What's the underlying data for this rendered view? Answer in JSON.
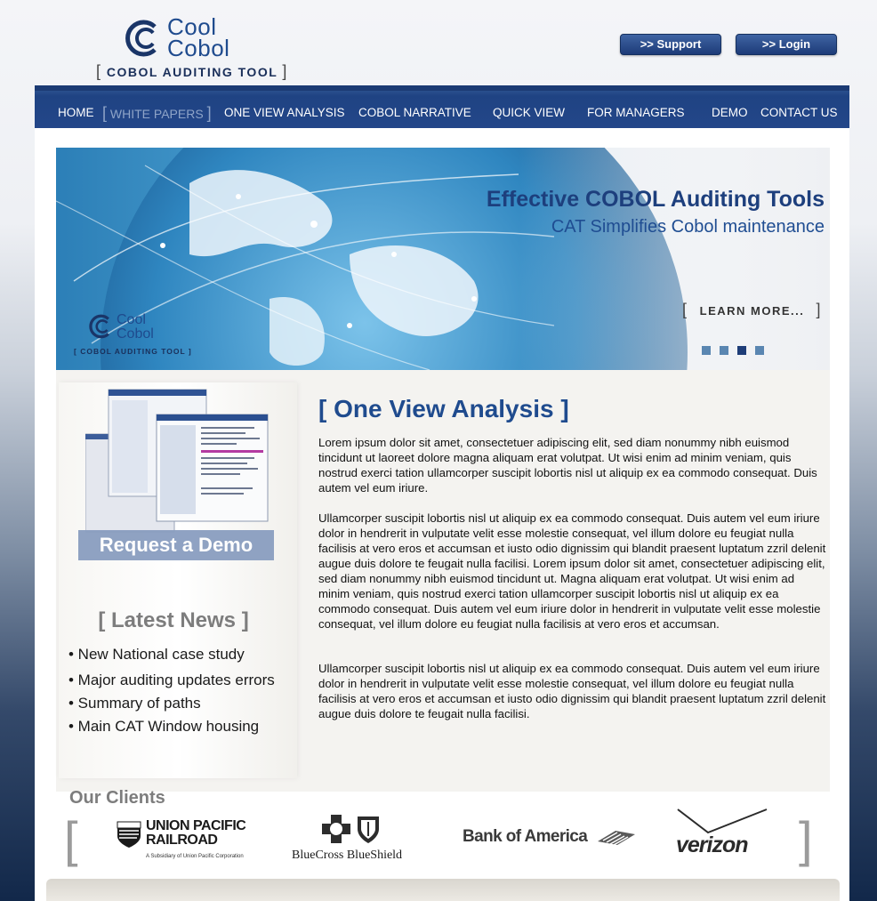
{
  "logo": {
    "line1": "Cool",
    "line2": "Cobol",
    "tagline": "COBOL AUDITING TOOL",
    "bracket_left": "[",
    "bracket_right": "]"
  },
  "top_buttons": {
    "support": ">> Support",
    "login": ">> Login"
  },
  "nav": {
    "home": "HOME",
    "white_papers": "WHITE PAPERS",
    "bracket_left": "[",
    "bracket_right": "]",
    "one_view": "ONE VIEW ANALYSIS",
    "narrative": "COBOL NARRATIVE",
    "quick_view": "QUICK VIEW",
    "managers": "FOR MANAGERS",
    "demo": "DEMO",
    "contact": "CONTACT US"
  },
  "hero": {
    "title": "Effective COBOL Auditing Tools",
    "subtitle": "CAT Simplifies Cobol maintenance",
    "learn_more": "LEARN MORE...",
    "bracket_left": "[",
    "bracket_right": "]",
    "slide_count": 4,
    "active_slide": 3,
    "logo_line1": "Cool",
    "logo_line2": "Cobol",
    "logo_tagline": "COBOL AUDITING TOOL"
  },
  "demo": {
    "label": "Request a Demo"
  },
  "news": {
    "title": "[ Latest News ]",
    "items": [
      "• New National case study",
      "• Major auditing updates errors",
      "• Summary of paths",
      "• Main CAT Window housing"
    ]
  },
  "main": {
    "title": "[ One View Analysis ]",
    "paragraphs": [
      "Lorem ipsum dolor sit amet, consectetuer adipiscing elit, sed diam nonummy nibh euismod tincidunt ut laoreet dolore magna aliquam erat volutpat. Ut wisi enim ad minim veniam, quis nostrud exerci tation ullamcorper suscipit lobortis nisl ut aliquip ex ea commodo consequat. Duis autem vel eum iriure.",
      "Ullamcorper suscipit lobortis nisl ut aliquip ex ea commodo consequat. Duis autem vel eum iriure dolor in hendrerit in vulputate velit esse molestie consequat, vel illum dolore eu feugiat nulla facilisis at vero eros et accumsan et iusto odio dignissim qui blandit praesent luptatum zzril delenit augue duis dolore te feugait nulla facilisi. Lorem ipsum dolor sit amet, consectetuer adipiscing elit, sed diam nonummy nibh euismod tincidunt ut.  Magna aliquam erat volutpat. Ut wisi enim ad minim veniam, quis nostrud exerci tation ullamcorper suscipit lobortis nisl ut aliquip ex ea commodo consequat. Duis autem vel eum iriure dolor in hendrerit in vulputate velit esse molestie consequat, vel illum dolore eu feugiat nulla facilisis at vero eros et accumsan.",
      "Ullamcorper suscipit lobortis nisl ut aliquip ex ea commodo consequat. Duis autem vel eum iriure dolor in hendrerit in vulputate velit esse molestie consequat, vel illum dolore eu feugiat nulla facilisis at vero eros et accumsan et iusto odio dignissim qui blandit praesent luptatum zzril delenit augue duis dolore te feugait nulla facilisi."
    ]
  },
  "clients": {
    "title": "Our Clients",
    "bracket_left": "[",
    "bracket_right": "]",
    "union_pacific": {
      "line1": "UNION PACIFIC",
      "line2": "RAILROAD",
      "sub": "A Subsidiary of Union Pacific Corporation",
      "badge": "UNION PACIFIC"
    },
    "bluecross": {
      "name": "BlueCross BlueShield"
    },
    "boa": {
      "name": "Bank of America"
    },
    "verizon": {
      "name": "verizon"
    }
  },
  "colors": {
    "brand_blue": "#1f4b8e",
    "nav_blue": "#24478a",
    "gray_heading": "#7d7d7d"
  }
}
